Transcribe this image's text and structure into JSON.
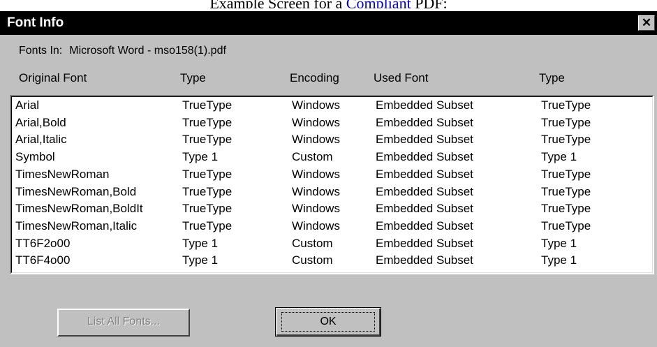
{
  "page": {
    "caption_before": "Example Screen for a ",
    "caption_link": "Compliant",
    "caption_after": " PDF:"
  },
  "dialog": {
    "title": "Font Info",
    "close_symbol": "✕",
    "fonts_in_label": "Fonts In:",
    "fonts_in_value": "Microsoft Word - mso158(1).pdf",
    "columns": [
      "Original Font",
      "Type",
      "Encoding",
      "Used Font",
      "Type"
    ],
    "rows": [
      [
        "Arial",
        "TrueType",
        "Windows",
        "Embedded Subset",
        "TrueType"
      ],
      [
        "Arial,Bold",
        "TrueType",
        "Windows",
        "Embedded Subset",
        "TrueType"
      ],
      [
        "Arial,Italic",
        "TrueType",
        "Windows",
        "Embedded Subset",
        "TrueType"
      ],
      [
        "Symbol",
        "Type 1",
        "Custom",
        "Embedded Subset",
        "Type 1"
      ],
      [
        "TimesNewRoman",
        "TrueType",
        "Windows",
        "Embedded Subset",
        "TrueType"
      ],
      [
        "TimesNewRoman,Bold",
        "TrueType",
        "Windows",
        "Embedded Subset",
        "TrueType"
      ],
      [
        "TimesNewRoman,BoldIt",
        "TrueType",
        "Windows",
        "Embedded Subset",
        "TrueType"
      ],
      [
        "TimesNewRoman,Italic",
        "TrueType",
        "Windows",
        "Embedded Subset",
        "TrueType"
      ],
      [
        "TT6F2o00",
        "Type 1",
        "Custom",
        "Embedded Subset",
        "Type 1"
      ],
      [
        "TT6F4o00",
        "Type 1",
        "Custom",
        "Embedded Subset",
        "Type 1"
      ]
    ],
    "list_all_fonts_label": "List All Fonts...",
    "ok_label": "OK"
  },
  "colors": {
    "titlebar": "#000000",
    "dialog_face": "#c0c0c0",
    "list_background": "#ffffff",
    "disabled_text": "#808080",
    "link": "#0000cc"
  }
}
